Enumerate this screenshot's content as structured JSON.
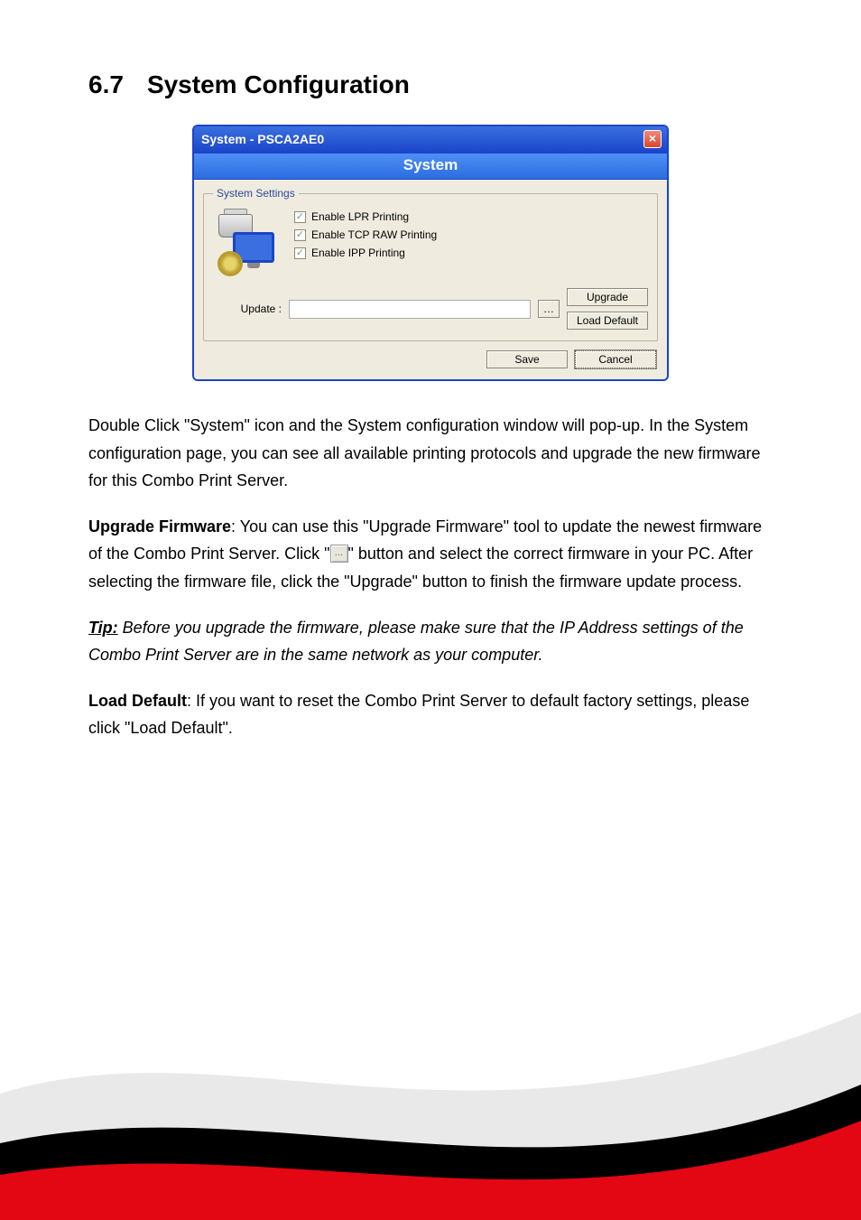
{
  "heading": {
    "number": "6.7",
    "title": "System Configuration"
  },
  "window": {
    "title": "System - PSCA2AE0",
    "banner": "System",
    "fieldset_legend": "System Settings",
    "checkboxes": [
      {
        "label": "Enable LPR Printing"
      },
      {
        "label": "Enable TCP RAW Printing"
      },
      {
        "label": "Enable IPP Printing"
      }
    ],
    "update_label": "Update :",
    "browse_label": "…",
    "upgrade_label": "Upgrade",
    "load_default_label": "Load Default",
    "save_label": "Save",
    "cancel_label": "Cancel",
    "close_glyph": "×"
  },
  "para1": "Double Click \"System\" icon and the System configuration window will pop-up. In the System configuration page, you can see all available printing protocols and upgrade the new firmware for this Combo Print Server.",
  "para2": {
    "lead": "Upgrade Firmware",
    "before_icon": ": You can use this \"Upgrade Firmware\" tool to update the newest firmware of the Combo Print Server. Click \"",
    "after_icon": "\" button and select the correct firmware in your PC. After selecting the firmware file, click the \"Upgrade\" button to finish the firmware update process."
  },
  "para3": {
    "tip": "Tip:",
    "text": " Before you upgrade the firmware, please make sure that the IP Address settings of the Combo Print Server are in the same network as your computer."
  },
  "para4": {
    "lead": "Load Default",
    "text": ": If you want to reset the Combo Print Server to default factory settings, please click \"Load Default\"."
  }
}
